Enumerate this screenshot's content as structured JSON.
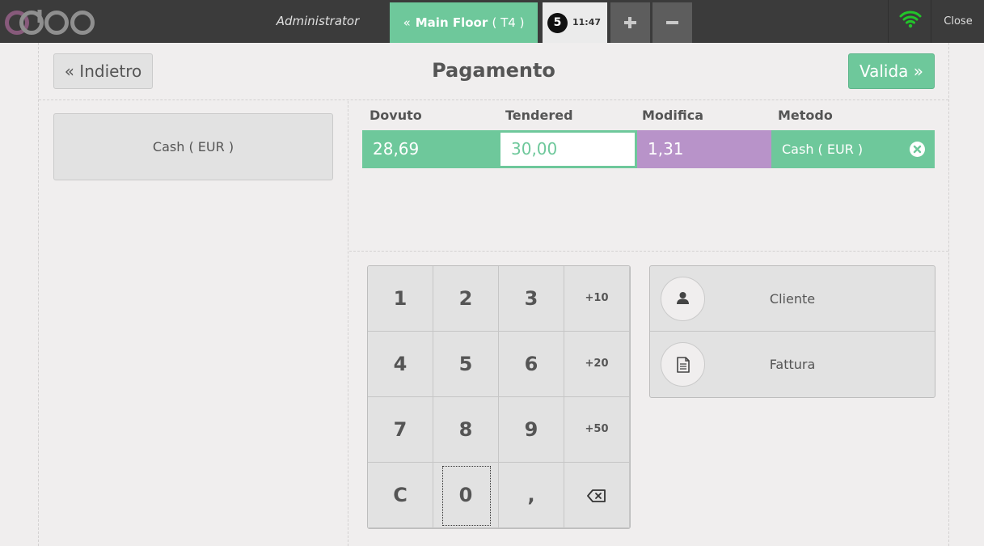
{
  "header": {
    "logo_text": "odoo",
    "user": "Administrator",
    "floor": {
      "name": "Main Floor",
      "table": "( T4 )"
    },
    "order": {
      "number": "5",
      "time": "11:47"
    },
    "close_label": "Close"
  },
  "payment": {
    "back_label": "« Indietro",
    "title": "Pagamento",
    "validate_label": "Valida »"
  },
  "payment_methods": [
    {
      "label": "Cash ( EUR )"
    }
  ],
  "lines_table": {
    "headers": {
      "due": "Dovuto",
      "tendered": "Tendered",
      "change": "Modifica",
      "method": "Metodo"
    },
    "rows": [
      {
        "due": "28,69",
        "tendered": "30,00",
        "change": "1,31",
        "method": "Cash ( EUR )"
      }
    ]
  },
  "numpad": {
    "keys": [
      "1",
      "2",
      "3",
      "+10",
      "4",
      "5",
      "6",
      "+20",
      "7",
      "8",
      "9",
      "+50",
      "C",
      "0",
      ",",
      "⌫"
    ]
  },
  "actions": [
    {
      "label": "Cliente",
      "icon": "user-icon"
    },
    {
      "label": "Fattura",
      "icon": "invoice-icon"
    }
  ],
  "colors": {
    "accent_green": "#6ec89b",
    "change_purple": "#b893c9",
    "logo_purple": "#875a7b",
    "topbar": "#3b3b3b"
  }
}
